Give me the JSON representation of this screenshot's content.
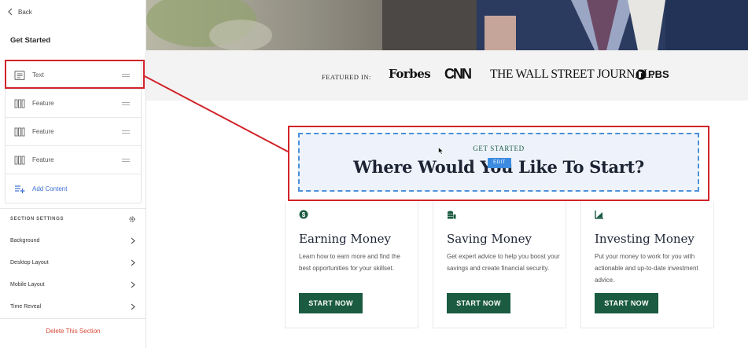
{
  "sidebar": {
    "back_label": "Back",
    "title": "Get Started",
    "items": [
      {
        "label": "Text",
        "icon": "text-block-icon"
      },
      {
        "label": "Feature",
        "icon": "feature-columns-icon"
      },
      {
        "label": "Feature",
        "icon": "feature-columns-icon"
      },
      {
        "label": "Feature",
        "icon": "feature-columns-icon"
      }
    ],
    "add_content_label": "Add Content",
    "section_settings_label": "SECTION SETTINGS",
    "settings": [
      {
        "label": "Background"
      },
      {
        "label": "Desktop Layout"
      },
      {
        "label": "Mobile Layout"
      },
      {
        "label": "Time Reveal"
      }
    ],
    "delete_label": "Delete This Section"
  },
  "featured": {
    "label": "FEATURED IN:",
    "logos": [
      "Forbes",
      "CNN",
      "THE WALL STREET JOURNAL.",
      "PBS"
    ]
  },
  "section": {
    "kicker": "GET STARTED",
    "heading": "Where Would You Like To Start?",
    "edit_badge": "EDIT"
  },
  "cards": [
    {
      "icon": "dollar-circle-icon",
      "title": "Earning Money",
      "description": "Learn how to earn more and find the best opportunities for your skillset.",
      "button": "START NOW"
    },
    {
      "icon": "coin-stack-icon",
      "title": "Saving Money",
      "description": "Get expert advice to help you boost your savings and create financial security.",
      "button": "START NOW"
    },
    {
      "icon": "growth-chart-icon",
      "title": "Investing Money",
      "description": "Put your money to work for you with actionable and up-to-date investment advice.",
      "button": "START NOW"
    }
  ],
  "colors": {
    "accent_green": "#1a5b41",
    "highlight_red": "#d2232a",
    "edit_blue": "#3d8be0",
    "link_blue": "#3b6fd6",
    "delete_red": "#d94a3a"
  }
}
